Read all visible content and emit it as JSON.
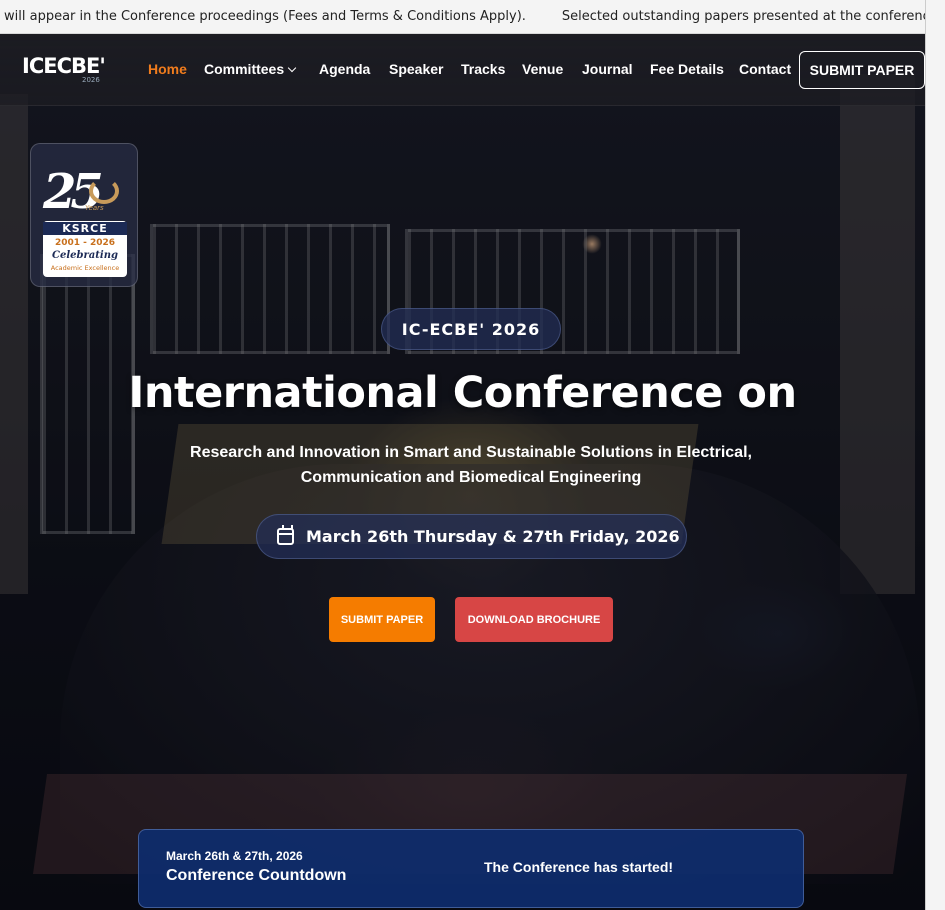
{
  "ticker": {
    "text1": "will appear in the Conference proceedings (Fees and Terms & Conditions Apply).",
    "text2": "Selected outstanding papers presented at the conference will b"
  },
  "nav": {
    "logo_text": "ICECBE'",
    "logo_year": "2026",
    "items": [
      {
        "label": "Home",
        "active": true
      },
      {
        "label": "Committees"
      },
      {
        "label": "Agenda"
      },
      {
        "label": "Speaker"
      },
      {
        "label": "Tracks"
      },
      {
        "label": "Venue"
      },
      {
        "label": "Journal"
      },
      {
        "label": "Fee Details"
      },
      {
        "label": "Contact"
      }
    ],
    "submit_label": "SUBMIT PAPER"
  },
  "badge": {
    "number": "25",
    "years": "Years",
    "org": "KSRCE",
    "span": "2001 - 2026",
    "celebrating": "Celebrating",
    "tagline": "Academic Excellence"
  },
  "hero": {
    "tag": "IC-ECBE' 2026",
    "title": "International Conference on",
    "subtitle": "Research and Innovation in Smart and Sustainable Solutions in Electrical, Communication and Biomedical Engineering",
    "date": "March 26th Thursday & 27th Friday, 2026",
    "submit_label": "SUBMIT PAPER",
    "brochure_label": "DOWNLOAD BROCHURE"
  },
  "countdown": {
    "date": "March 26th & 27th, 2026",
    "title": "Conference Countdown",
    "status": "The Conference has started!"
  },
  "colors": {
    "accent_orange": "#f57c00",
    "brochure_red": "#d74645",
    "countdown_blue": "#0e2d6e"
  }
}
